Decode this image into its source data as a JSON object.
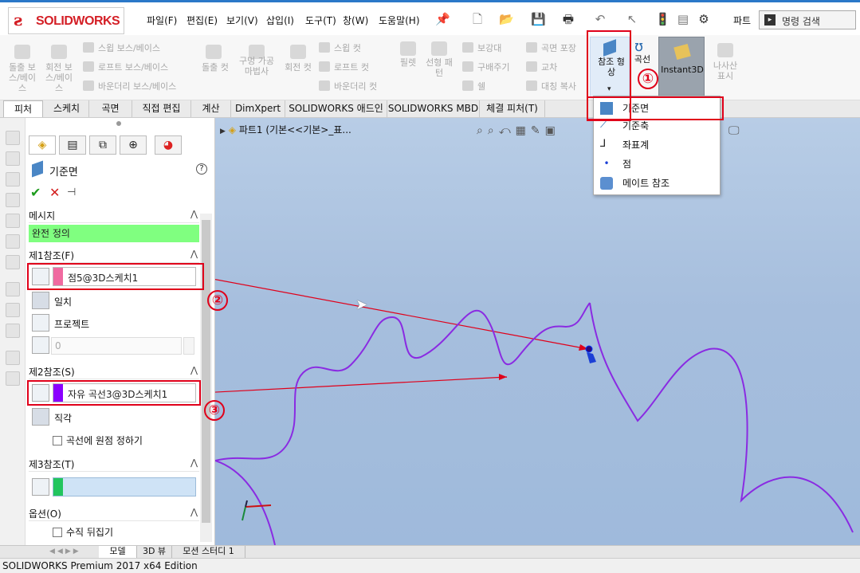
{
  "app": {
    "brand": "SOLIDWORKS"
  },
  "menu": [
    "파일(F)",
    "편집(E)",
    "보기(V)",
    "삽입(I)",
    "도구(T)",
    "창(W)",
    "도움말(H)"
  ],
  "toolbar_right": {
    "doc_type": "파트",
    "search_placeholder": "명령 검색"
  },
  "ribbon": {
    "extrude_boss": "돌출 보\n스/베이\n스",
    "revolve_boss": "회전 보\n스/베이\n스",
    "sweep_boss": "스윕 보스/베이스",
    "loft_boss": "로프트 보스/베이스",
    "boundary_boss": "바운더리 보스/베이스",
    "extrude_cut": "돌출 컷",
    "hole_wizard": "구멍 가공\n마법사",
    "revolve_cut": "회전 컷",
    "sweep_cut": "스윕 컷",
    "loft_cut": "로프트 컷",
    "boundary_cut": "바운더리 컷",
    "fillet": "필렛",
    "linear_pattern": "선형 패\n턴",
    "rib": "보강대",
    "draft": "구배주기",
    "shell": "쉘",
    "wrap": "곡면 포장",
    "intersect": "교차",
    "mirror": "대칭 복사",
    "ref_geometry": "참조 형\n상",
    "curves": "곡선",
    "instant3d": "Instant3D",
    "cosmetic_thread": "나사산\n표시"
  },
  "tabs": [
    "피처",
    "스케치",
    "곡면",
    "직접 편집",
    "계산",
    "DimXpert",
    "SOLIDWORKS 애드인",
    "SOLIDWORKS MBD",
    "체결 피처(T)"
  ],
  "dropdown": {
    "items": [
      "기준면",
      "기준축",
      "좌표계",
      "점",
      "메이트 참조"
    ]
  },
  "property_manager": {
    "title": "기준면",
    "message_header": "메시지",
    "message_text": "완전 정의",
    "first_ref": {
      "header": "제1참조(F)",
      "value": "점5@3D스케치1",
      "options": [
        "일치",
        "프로젝트"
      ],
      "number": "0"
    },
    "second_ref": {
      "header": "제2참조(S)",
      "value": "자유 곡선3@3D스케치1",
      "options": [
        "직각"
      ],
      "checkbox": "곡선에 원점 정하기"
    },
    "third_ref": {
      "header": "제3참조(T)",
      "value": ""
    },
    "options": {
      "header": "옵션(O)",
      "checkbox": "수직 뒤집기"
    }
  },
  "viewport": {
    "breadcrumb": "파트1  (기본<<기본>_표..."
  },
  "annotations": [
    "①",
    "②",
    "③"
  ],
  "bottom_tabs": [
    "모델",
    "3D 뷰",
    "모션 스터디 1"
  ],
  "status": "SOLIDWORKS Premium 2017 x64 Edition",
  "colors": {
    "curve": "#8a2be2",
    "highlight_red": "#e0001a",
    "first_ref_swatch": "#f06aa0",
    "second_ref_swatch": "#8a00ff",
    "third_ref_swatch": "#22c55e",
    "message_bg": "#80ff80"
  }
}
